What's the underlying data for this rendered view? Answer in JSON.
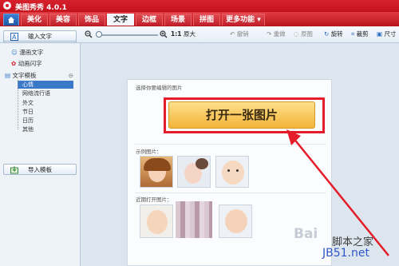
{
  "window": {
    "title": "美图秀秀 4.0.1"
  },
  "tabs": [
    {
      "label": "",
      "icon": "home-icon"
    },
    {
      "label": "美化"
    },
    {
      "label": "美容"
    },
    {
      "label": "饰品"
    },
    {
      "label": "文字"
    },
    {
      "label": "边框"
    },
    {
      "label": "场景"
    },
    {
      "label": "拼图"
    },
    {
      "label": "更多功能 ▾"
    }
  ],
  "toolbar": {
    "zoom_ratio": "1:1",
    "original_size": "原大",
    "undo": "撤销",
    "redo": "重做",
    "original": "原图",
    "rotate": "旋转",
    "crop": "裁剪",
    "resize": "尺寸"
  },
  "sidebar": {
    "input_text": "输入文字",
    "comic_text": "漫画文字",
    "animated_text": "动画闪字",
    "template_header": "文字模板",
    "template_items": [
      "心情",
      "网络流行语",
      "外文",
      "节日",
      "日历",
      "其他"
    ],
    "import_template": "导入模板"
  },
  "main": {
    "prompt": "选择你要编辑的图片",
    "open_button": "打开一张图片",
    "examples_label": "示例图片：",
    "recent_label": "近期打开图片："
  },
  "watermark": {
    "baidu": "Bai",
    "site_cn": "脚本之家",
    "site_url": "JB51.net"
  },
  "colors": {
    "brand_red": "#d7212c",
    "highlight_red": "#e51d2a",
    "button_gold": "#f3b43a"
  }
}
